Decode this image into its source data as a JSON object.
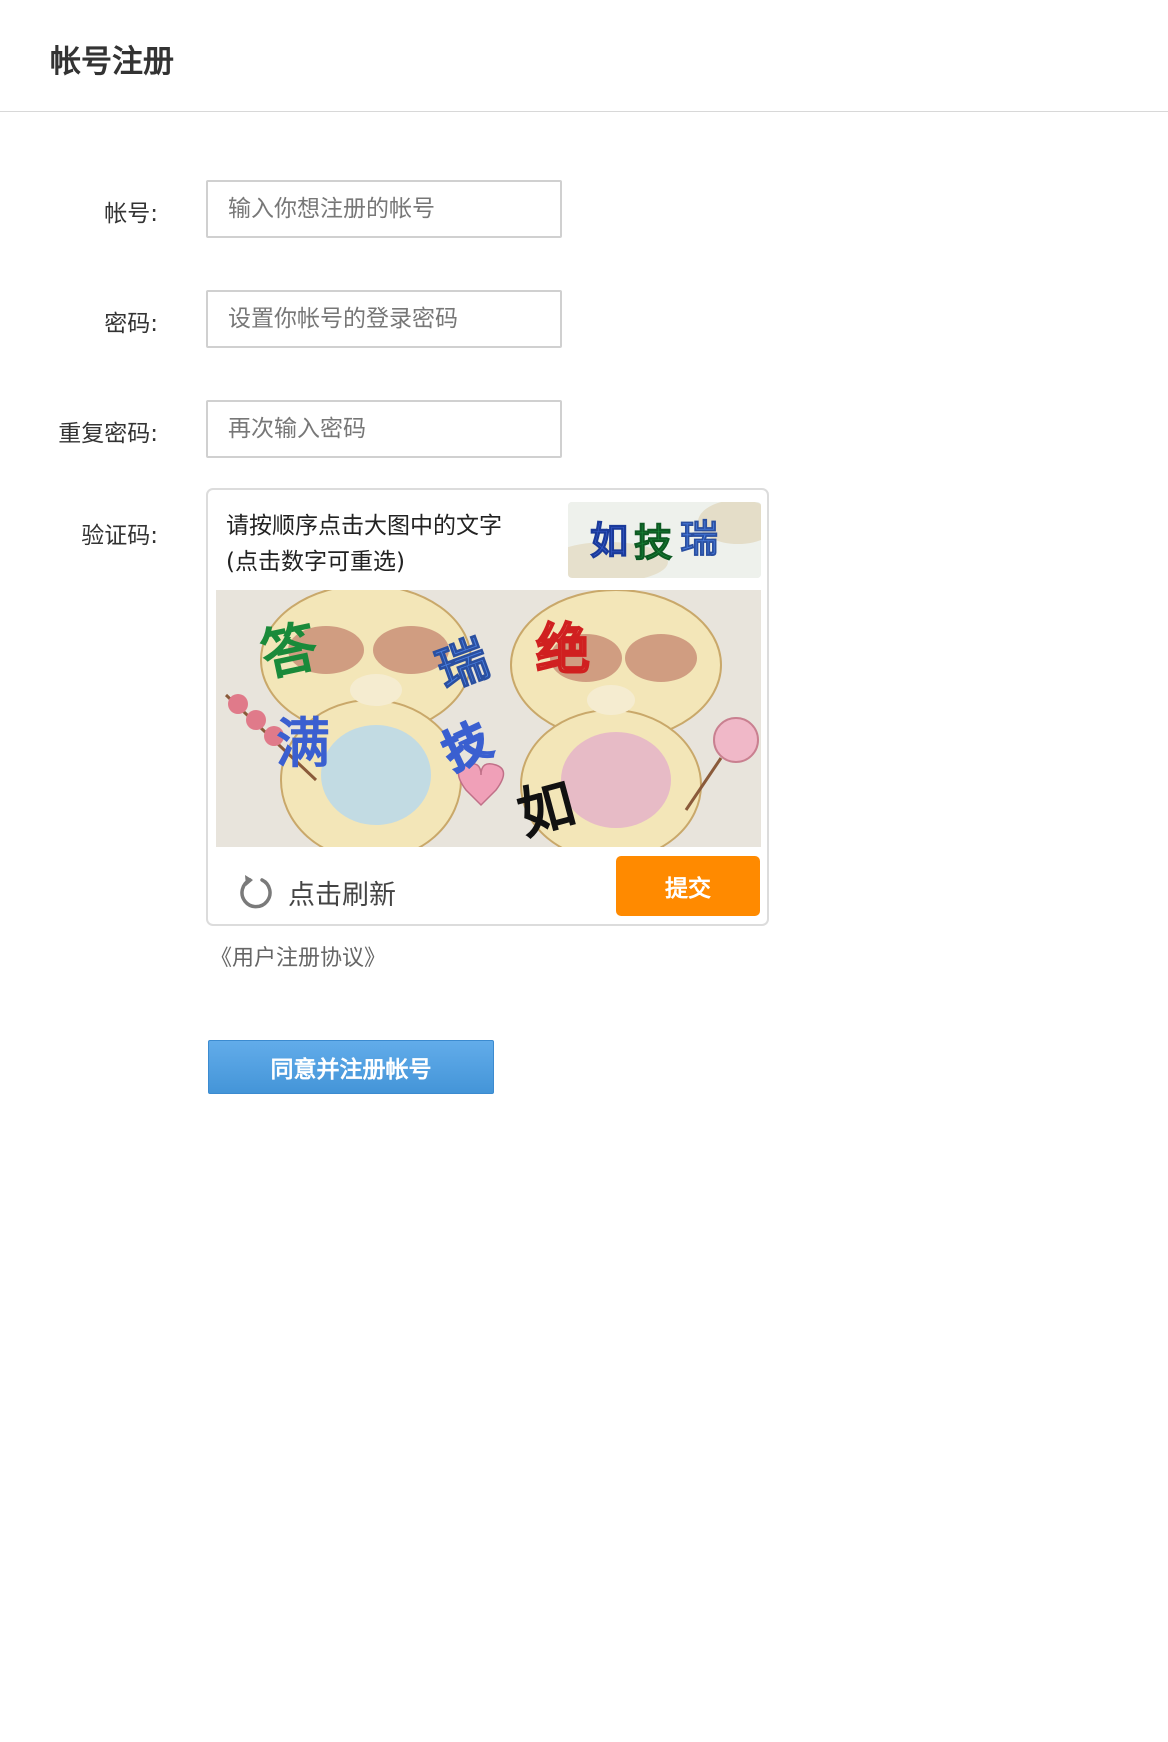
{
  "header": {
    "title": "帐号注册"
  },
  "form": {
    "account": {
      "label": "帐号:",
      "placeholder": "输入你想注册的帐号"
    },
    "password": {
      "label": "密码:",
      "placeholder": "设置你帐号的登录密码"
    },
    "confirm": {
      "label": "重复密码:",
      "placeholder": "再次输入密码"
    },
    "captcha_label": "验证码:"
  },
  "captcha": {
    "instruction_line1": "请按顺序点击大图中的文字",
    "instruction_line2": "(点击数字可重选)",
    "sequence_chars": [
      "如",
      "技",
      "瑞"
    ],
    "image_chars": [
      "答",
      "瑞",
      "绝",
      "满",
      "技",
      "如"
    ],
    "refresh_label": "点击刷新",
    "submit_label": "提交",
    "colors": {
      "submit": "#ff8a00",
      "green": "#1a8a3a",
      "blue": "#3a5fd0",
      "red": "#d02020"
    }
  },
  "agreement_link": "《用户注册协议》",
  "register_button": "同意并注册帐号"
}
